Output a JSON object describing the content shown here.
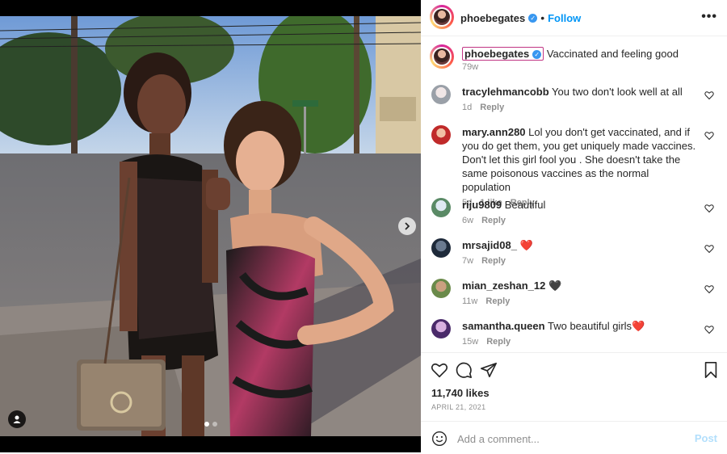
{
  "header": {
    "username": "phoebegates",
    "separator": "•",
    "follow_label": "Follow",
    "more_icon": "more-horizontal-icon"
  },
  "caption": {
    "username": "phoebegates",
    "text": "Vaccinated and feeling good",
    "time": "79w"
  },
  "comments": [
    {
      "user": "tracylehmancobb",
      "text": "You two don't look well at all",
      "time": "1d",
      "likes": "",
      "reply": "Reply"
    },
    {
      "user": "mary.ann280",
      "text": "Lol you don't get vaccinated, and if you do get them, you get uniquely made vaccines. Don't let this girl fool you . She doesn't take the same poisonous vaccines as the normal population",
      "time": "5d",
      "likes": "1 like",
      "reply": "Reply"
    },
    {
      "user": "riju9809",
      "text": "Beautiful",
      "time": "6w",
      "likes": "",
      "reply": "Reply"
    },
    {
      "user": "mrsajid08_",
      "text": "❤️",
      "time": "7w",
      "likes": "",
      "reply": "Reply"
    },
    {
      "user": "mian_zeshan_12",
      "text": "🖤",
      "time": "11w",
      "likes": "",
      "reply": "Reply"
    },
    {
      "user": "samantha.queen",
      "text": "Two beautiful girls❤️",
      "time": "15w",
      "likes": "",
      "reply": "Reply"
    }
  ],
  "actions": {
    "likes": "11,740 likes",
    "date": "APRIL 21, 2021"
  },
  "composer": {
    "placeholder": "Add a comment...",
    "post_label": "Post"
  },
  "carousel": {
    "slide_count": 2,
    "active_index": 0
  },
  "colors": {
    "accent": "#0095f6",
    "verified": "#3897f0",
    "muted": "#8e8e8e"
  }
}
